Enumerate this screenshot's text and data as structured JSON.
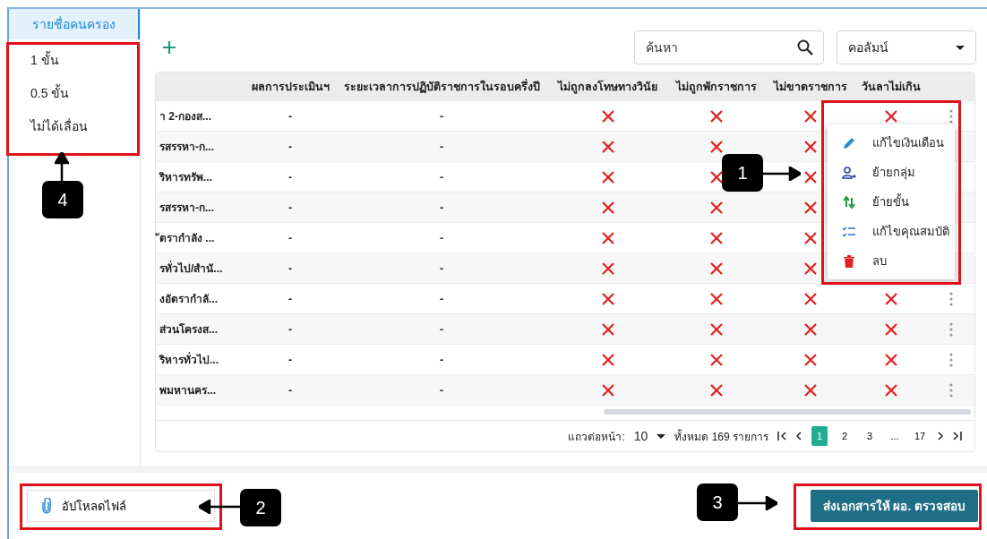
{
  "sidebar": {
    "items": [
      {
        "label": "รายชื่อคนครอง",
        "selected": true
      },
      {
        "label": "1 ขั้น",
        "selected": false
      },
      {
        "label": "0.5 ขั้น",
        "selected": false
      },
      {
        "label": "ไม่ได้เลื่อน",
        "selected": false
      }
    ]
  },
  "search": {
    "placeholder": "ค้นหา"
  },
  "column_picker": {
    "label": "คอลัมน์"
  },
  "table": {
    "columns": [
      "ผลการประเมินฯ",
      "ระยะเวลาการปฏิบัติราชการในรอบครึ่งปี",
      "ไม่ถูกลงโทษทางวินัย",
      "ไม่ถูกพักราชการ",
      "ไม่ขาดราชการ",
      "วันลาไม่เกิน"
    ],
    "rows": [
      {
        "column_1": "า 2-กองส...",
        "result": "-",
        "period": "-",
        "checks": [
          false,
          false,
          false,
          false
        ],
        "menu_button": true
      },
      {
        "column_1": "รสรรหา-ก...",
        "result": "-",
        "period": "-",
        "checks": [
          false,
          false,
          false
        ],
        "menu_button": false
      },
      {
        "column_1": "ริหารทรัพ...",
        "result": "-",
        "period": "-",
        "checks": [
          false,
          false,
          false
        ],
        "menu_button": false
      },
      {
        "column_1": "รสรรหา-ก...",
        "result": "-",
        "period": "-",
        "checks": [
          false,
          false,
          false
        ],
        "menu_button": false
      },
      {
        "column_1": "ัตรากำลัง ...",
        "result": "-",
        "period": "-",
        "checks": [
          false,
          false,
          false
        ],
        "menu_button": false
      },
      {
        "column_1": "รทั่วไป/สำนั...",
        "result": "-",
        "period": "-",
        "checks": [
          false,
          false,
          false
        ],
        "menu_button": false
      },
      {
        "column_1": "งอัตรากำลั...",
        "result": "-",
        "period": "-",
        "checks": [
          false,
          false,
          false,
          false
        ],
        "menu_button": true
      },
      {
        "column_1": "ส่วนโครงส...",
        "result": "-",
        "period": "-",
        "checks": [
          false,
          false,
          false,
          false
        ],
        "menu_button": true
      },
      {
        "column_1": "ริหารทั่วไป...",
        "result": "-",
        "period": "-",
        "checks": [
          false,
          false,
          false,
          false
        ],
        "menu_button": true
      },
      {
        "column_1": "พมหานคร...",
        "result": "-",
        "period": "-",
        "checks": [
          false,
          false,
          false,
          false
        ],
        "menu_button": true
      }
    ]
  },
  "context_menu": {
    "items": [
      {
        "label": "แก้ไขเงินเดือน",
        "kind": "edit"
      },
      {
        "label": "ย้ายกลุ่ม",
        "kind": "move-group"
      },
      {
        "label": "ย้ายขั้น",
        "kind": "move-step"
      },
      {
        "label": "แก้ไขคุณสมบัติ",
        "kind": "edit-list"
      },
      {
        "label": "ลบ",
        "kind": "delete"
      }
    ]
  },
  "pagination": {
    "rows_label": "แถวต่อหน้า:",
    "rows_value": "10",
    "total": "ทั้งหมด 169 รายการ",
    "pages": [
      {
        "label": "1",
        "selected": true
      },
      {
        "label": "2",
        "selected": false
      },
      {
        "label": "3",
        "selected": false
      },
      {
        "label": "...",
        "selected": false
      },
      {
        "label": "17",
        "selected": false
      }
    ]
  },
  "upload_button": {
    "label": "อัปโหลดไฟล์"
  },
  "submit_button": {
    "label": "ส่งเอกสารให้ ผอ. ตรวจสอบ"
  },
  "annotations": [
    {
      "label": "1"
    },
    {
      "label": "2"
    },
    {
      "label": "3"
    },
    {
      "label": "4"
    }
  ]
}
